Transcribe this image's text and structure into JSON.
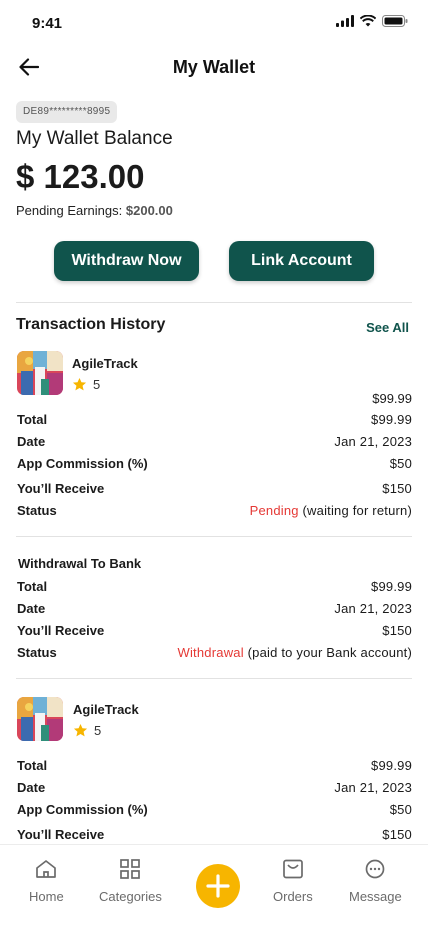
{
  "status_bar": {
    "time": "9:41"
  },
  "header": {
    "title": "My Wallet"
  },
  "wallet": {
    "account_masked": "DE89*********8995",
    "balance_label": "My Wallet Balance",
    "balance": "$ 123.00",
    "pending_label": "Pending Earnings:",
    "pending_value": "$200.00"
  },
  "actions": {
    "withdraw_label": "Withdraw Now",
    "link_label": "Link Account"
  },
  "history": {
    "title": "Transaction History",
    "see_all": "See All"
  },
  "transactions": [
    {
      "app_name": "AgileTrack",
      "rating": "5",
      "amount": "$99.99",
      "total_label": "Total",
      "total": "$99.99",
      "date_label": "Date",
      "date": "Jan 21, 2023",
      "commission_label": "App Commission (%)",
      "commission": "$50",
      "receive_label": "You’ll Receive",
      "receive": "$150",
      "status_label": "Status",
      "status": "Pending",
      "status_note": "(waiting for return)"
    },
    {
      "title": "Withdrawal To Bank",
      "total_label": "Total",
      "total": "$99.99",
      "date_label": "Date",
      "date": "Jan 21, 2023",
      "receive_label": "You’ll Receive",
      "receive": "$150",
      "status_label": "Status",
      "status": "Withdrawal",
      "status_note": "(paid to your Bank account)"
    },
    {
      "app_name": "AgileTrack",
      "rating": "5",
      "total_label": "Total",
      "total": "$99.99",
      "date_label": "Date",
      "date": "Jan 21, 2023",
      "commission_label": "App Commission (%)",
      "commission": "$50",
      "receive_label": "You’ll Receive",
      "receive": "$150"
    }
  ],
  "nav": {
    "home": "Home",
    "categories": "Categories",
    "orders": "Orders",
    "message": "Message"
  },
  "colors": {
    "primary": "#10544c",
    "accent": "#f7b500",
    "status_red": "#e53935"
  }
}
